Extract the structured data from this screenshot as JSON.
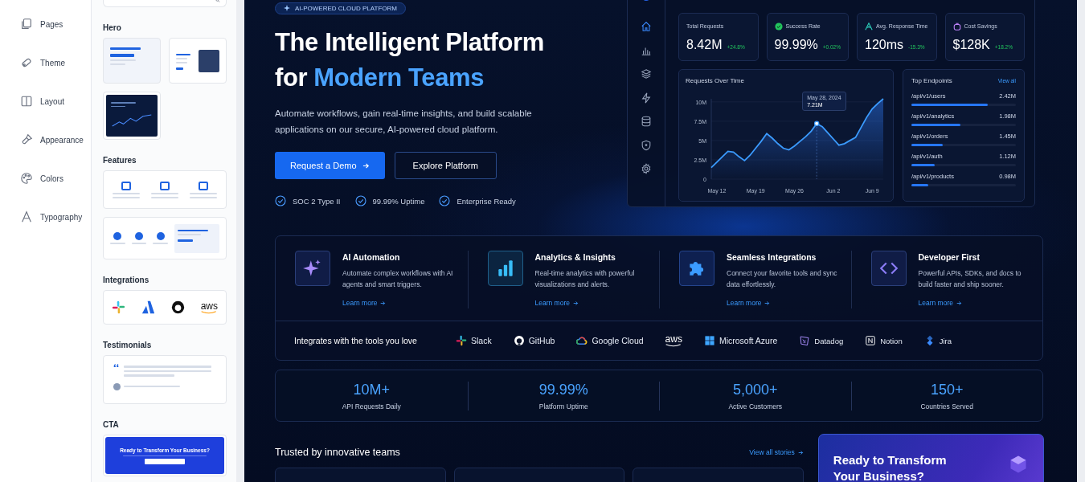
{
  "nav": [
    {
      "kind": "pages",
      "label": "Pages"
    },
    {
      "kind": "theme",
      "label": "Theme"
    },
    {
      "kind": "layout",
      "label": "Layout"
    },
    {
      "kind": "appearance",
      "label": "Appearance"
    },
    {
      "kind": "colors",
      "label": "Colors"
    },
    {
      "kind": "typography",
      "label": "Typography"
    }
  ],
  "library": {
    "sections": [
      {
        "title": "Hero",
        "thumbnails": [
          {
            "kind": "hero-light"
          },
          {
            "kind": "hero-image"
          },
          {
            "kind": "hero-dark"
          }
        ]
      },
      {
        "title": "Features",
        "thumbnails": [
          {
            "kind": "features-three"
          },
          {
            "kind": "features-image"
          }
        ]
      },
      {
        "title": "Integrations",
        "thumbnails": [
          {
            "kind": "logos",
            "text": "aws"
          }
        ]
      },
      {
        "title": "Testimonials",
        "thumbnails": [
          {
            "kind": "testimonial"
          }
        ]
      },
      {
        "title": "CTA",
        "thumbnails": [
          {
            "kind": "cta",
            "text": "Ready to Transform Your Business?"
          }
        ]
      }
    ]
  },
  "hero": {
    "badge": "AI-POWERED CLOUD PLATFORM",
    "title": {
      "line1": "The Intelligent Platform",
      "lead": "for",
      "accent": "Modern Teams"
    },
    "text": "Automate workflows, gain real-time insights, and build scalable applications on our secure, AI-powered cloud platform.",
    "primary_button": "Request a Demo",
    "secondary_button": "Explore Platform",
    "checks": [
      "SOC 2 Type II",
      "99.99% Uptime",
      "Enterprise Ready"
    ]
  },
  "dashboard": {
    "nav": [
      {
        "kind": "home",
        "selected": true
      },
      {
        "kind": "chart",
        "selected": false
      },
      {
        "kind": "layers",
        "selected": false
      },
      {
        "kind": "bolt",
        "selected": false
      },
      {
        "kind": "database",
        "selected": false
      },
      {
        "kind": "shield",
        "selected": false
      },
      {
        "kind": "gear",
        "selected": false
      }
    ],
    "stats": [
      {
        "kind": "plain",
        "label": "Total Requests",
        "value": "8.42M",
        "change": "+24.8%"
      },
      {
        "kind": "success",
        "label": "Success Rate",
        "value": "99.99%",
        "change": "+0.02%"
      },
      {
        "kind": "response",
        "label": "Avg. Response Time",
        "value": "120ms",
        "change": "-15.3%"
      },
      {
        "kind": "savings",
        "label": "Cost Savings",
        "value": "$128K",
        "change": "+18.2%"
      }
    ],
    "chart": {
      "tooltip_date": "May 28, 2024",
      "chart_data": {
        "type": "area",
        "title": "Requests Over Time",
        "categories": [
          null,
          "May 12",
          null,
          null,
          null,
          null,
          null,
          null,
          "May 19",
          null,
          null,
          null,
          null,
          null,
          null,
          "May 26",
          null,
          null,
          null,
          null,
          null,
          null,
          "Jun 2",
          null,
          null,
          null,
          null,
          null,
          null,
          "Jun 9",
          null,
          null
        ],
        "series": [
          {
            "color": "#3b9bff",
            "values": [
              1.5,
              2.2,
              2.9,
              3.6,
              3.5,
              2.9,
              2.4,
              3.1,
              4.0,
              4.9,
              5.9,
              5.3,
              4.6,
              4.0,
              3.8,
              4.3,
              4.9,
              5.5,
              6.2,
              7.2,
              6.8,
              6.0,
              5.2,
              4.4,
              4.6,
              5.0,
              5.4,
              6.7,
              8.0,
              9.1,
              9.8,
              10.4
            ]
          }
        ],
        "grid": true,
        "ylim": [
          0,
          10.4
        ],
        "yticks": [
          {
            "value": 0,
            "label": "0"
          },
          {
            "value": 2.5,
            "label": "2.5M"
          },
          {
            "value": 5,
            "label": "5M"
          },
          {
            "value": 7.5,
            "label": "7.5M"
          },
          {
            "value": 10,
            "label": "10M"
          }
        ],
        "annotations": [
          {
            "y": 7.2,
            "text": "7.21M"
          }
        ]
      }
    },
    "endpoints": {
      "title": "Top Endpoints",
      "link": "View all",
      "items": [
        {
          "path": "/api/v1/users",
          "count": "2.42M",
          "level": 0.73
        },
        {
          "path": "/api/v1/analytics",
          "count": "1.98M",
          "level": 0.47
        },
        {
          "path": "/api/v1/orders",
          "count": "1.45M",
          "level": 0.3
        },
        {
          "path": "/api/v1/auth",
          "count": "1.12M",
          "level": 0.22
        },
        {
          "path": "/api/v1/products",
          "count": "0.98M",
          "level": 0.16
        }
      ]
    }
  },
  "features": [
    {
      "kind": "sparkle",
      "title": "AI Automation",
      "text": "Automate complex workflows with AI agents and smart triggers.",
      "link": "Learn more"
    },
    {
      "kind": "bars",
      "title": "Analytics & Insights",
      "text": "Real-time analytics with powerful visualizations and alerts.",
      "link": "Learn more"
    },
    {
      "kind": "puzzle",
      "title": "Seamless Integrations",
      "text": "Connect your favorite tools and sync data effortlessly.",
      "link": "Learn more"
    },
    {
      "kind": "code",
      "title": "Developer First",
      "text": "Powerful APIs, SDKs, and docs to build faster and ship sooner.",
      "link": "Learn more"
    }
  ],
  "integrations": {
    "label": "Integrates with the tools you love",
    "tools": [
      {
        "kind": "slack",
        "name": "Slack"
      },
      {
        "kind": "github",
        "name": "GitHub"
      },
      {
        "kind": "google-cloud",
        "name": "Google Cloud"
      },
      {
        "kind": "aws",
        "name": "aws"
      },
      {
        "kind": "azure",
        "name": "Microsoft Azure"
      },
      {
        "kind": "datadog",
        "name": "Datadog"
      },
      {
        "kind": "notion",
        "name": "Notion"
      },
      {
        "kind": "jira",
        "name": "Jira"
      }
    ]
  },
  "metrics": [
    {
      "value": "10M+",
      "label": "API Requests Daily"
    },
    {
      "value": "99.99%",
      "label": "Platform Uptime"
    },
    {
      "value": "5,000+",
      "label": "Active Customers"
    },
    {
      "value": "150+",
      "label": "Countries Served"
    }
  ],
  "stories": {
    "title": "Trusted by innovative teams",
    "link": "View all stories"
  },
  "cta": {
    "title": "Ready to Transform Your Business?"
  }
}
